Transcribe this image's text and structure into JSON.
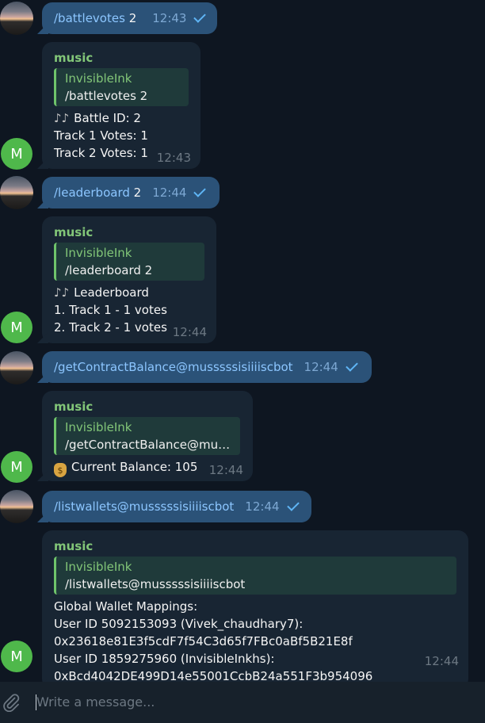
{
  "conversation": {
    "m1": {
      "cmd": "/battlevotes",
      "arg": "2",
      "time": "12:43"
    },
    "m2": {
      "sender": "music",
      "reply_name": "InvisibleInk",
      "reply_text": "/battlevotes 2",
      "icon": "musical-notes-icon",
      "lines": [
        "Battle ID: 2",
        "Track 1 Votes: 1",
        "Track 2 Votes: 1"
      ],
      "time": "12:43"
    },
    "m3": {
      "cmd": "/leaderboard",
      "arg": "2",
      "time": "12:44"
    },
    "m4": {
      "sender": "music",
      "reply_name": "InvisibleInk",
      "reply_text": "/leaderboard 2",
      "icon": "musical-notes-icon",
      "lines": [
        "Leaderboard",
        "1. Track 1 - 1 votes",
        "2. Track 2 - 1 votes"
      ],
      "time": "12:44"
    },
    "m5": {
      "cmd": "/getContractBalance@musssssisiiiiscbot",
      "time": "12:44"
    },
    "m6": {
      "sender": "music",
      "reply_name": "InvisibleInk",
      "reply_text": "/getContractBalance@mus...",
      "icon": "money-bag-icon",
      "lines": [
        "Current Balance: 105"
      ],
      "time": "12:44"
    },
    "m7": {
      "cmd": "/listwallets@musssssisiiiiscbot",
      "time": "12:44"
    },
    "m8": {
      "sender": "music",
      "reply_name": "InvisibleInk",
      "reply_text": "/listwallets@musssssisiiiiscbot",
      "lines": [
        "Global Wallet Mappings:",
        "User ID 5092153093 (Vivek_chaudhary7):",
        "0x23618e81E3f5cdF7f54C3d65f7FBc0aBf5B21E8f",
        "User ID 1859275960 (InvisibleInkhs):",
        "0xBcd4042DE499D14e55001CcbB24a551F3b954096"
      ],
      "time": "12:44"
    }
  },
  "avatars": {
    "bot_initial": "M"
  },
  "input": {
    "placeholder": "Write a message..."
  },
  "colors": {
    "background": "#0e1621",
    "outgoing": "#2b5278",
    "incoming": "#182533",
    "accent_green": "#82c678",
    "link": "#8cc6ff"
  }
}
